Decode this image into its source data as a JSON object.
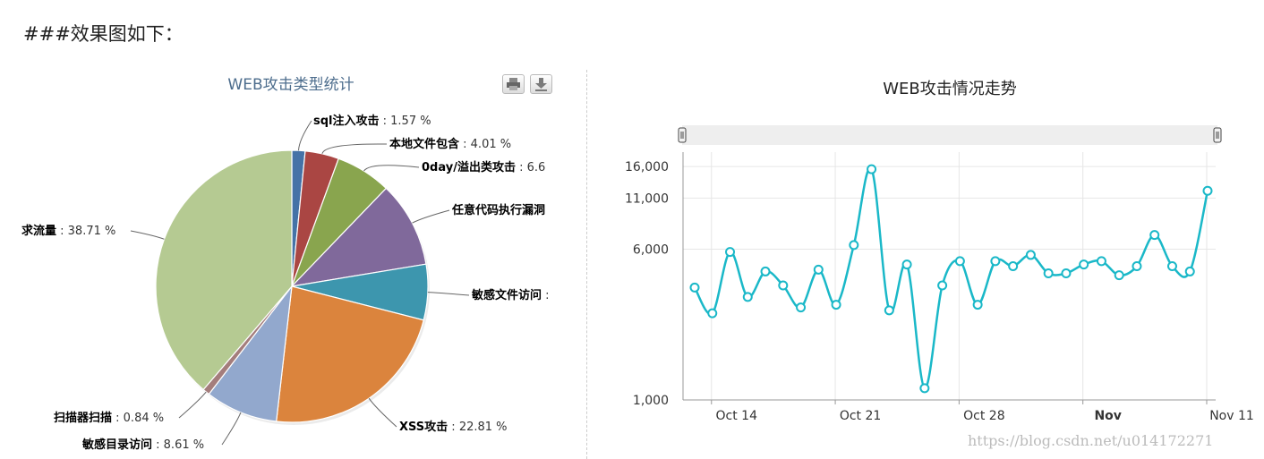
{
  "page": {
    "heading": "###效果图如下：",
    "watermark": "https://blog.csdn.net/u014172271"
  },
  "colors": {
    "line_series": "#1ab8c8",
    "pie_title": "#4d6d8d"
  },
  "pie_toolbar": {
    "buttons": [
      "printer-icon",
      "download-icon"
    ]
  },
  "chart_data": [
    {
      "type": "pie",
      "title": "WEB攻击类型统计",
      "slices": [
        {
          "name": "sql注入攻击",
          "value": 1.57,
          "label": "sql注入攻击",
          "percent_text": ": 1.57 %",
          "color": "#4572a7"
        },
        {
          "name": "本地文件包含",
          "value": 4.01,
          "label": "本地文件包含",
          "percent_text": ": 4.01 %",
          "color": "#aa4643"
        },
        {
          "name": "0day/溢出类攻击",
          "value": 6.6,
          "label": "0day/溢出类攻击",
          "percent_text": ": 6.6",
          "color": "#89a54e"
        },
        {
          "name": "任意代码执行漏洞",
          "value": 10.2,
          "label": "任意代码执行漏洞",
          "percent_text": "",
          "color": "#80699b"
        },
        {
          "name": "敏感文件访问",
          "value": 6.6,
          "label": "敏感文件访问",
          "percent_text": ":",
          "color": "#3d96ae"
        },
        {
          "name": "XSS攻击",
          "value": 22.81,
          "label": "XSS攻击",
          "percent_text": ": 22.81 %",
          "color": "#db843d"
        },
        {
          "name": "敏感目录访问",
          "value": 8.61,
          "label": "敏感目录访问",
          "percent_text": ": 8.61 %",
          "color": "#92a8cd"
        },
        {
          "name": "扫描器扫描",
          "value": 0.84,
          "label": "扫描器扫描",
          "percent_text": ": 0.84 %",
          "color": "#a47d7c"
        },
        {
          "name": "求流量",
          "value": 38.71,
          "label": "求流量",
          "percent_text": ": 38.71 %",
          "color": "#b5ca92"
        }
      ]
    },
    {
      "type": "line",
      "title": "WEB攻击情况走势",
      "yscale": "log",
      "ylim": [
        1000,
        19000
      ],
      "yticks": [
        1000,
        6000,
        11000,
        16000
      ],
      "ytick_labels": [
        "1,000",
        "6,000",
        "11,000",
        "16,000"
      ],
      "xticks": [
        "Oct 14",
        "Oct 21",
        "Oct 28",
        "Nov",
        "Nov 11"
      ],
      "xtick_bold": [
        false,
        false,
        false,
        true,
        false
      ],
      "x_start": "2017-10-13",
      "x_end": "2017-11-11",
      "series": [
        {
          "x": [
            "2017-10-13",
            "2017-10-14",
            "2017-10-15",
            "2017-10-16",
            "2017-10-17",
            "2017-10-18",
            "2017-10-19",
            "2017-10-20",
            "2017-10-21",
            "2017-10-22",
            "2017-10-23",
            "2017-10-24",
            "2017-10-25",
            "2017-10-26",
            "2017-10-27",
            "2017-10-28",
            "2017-10-29",
            "2017-10-30",
            "2017-10-31",
            "2017-11-01",
            "2017-11-02",
            "2017-11-03",
            "2017-11-04",
            "2017-11-05",
            "2017-11-06",
            "2017-11-07",
            "2017-11-08",
            "2017-11-09",
            "2017-11-10",
            "2017-11-11"
          ],
          "y": [
            3800,
            2800,
            5800,
            3400,
            4600,
            3900,
            3000,
            4700,
            3100,
            6300,
            15500,
            2900,
            5000,
            1150,
            3900,
            5200,
            3100,
            5200,
            4900,
            5600,
            4500,
            4500,
            5000,
            5200,
            4400,
            4900,
            7100,
            4900,
            4600,
            12000
          ]
        }
      ]
    }
  ]
}
